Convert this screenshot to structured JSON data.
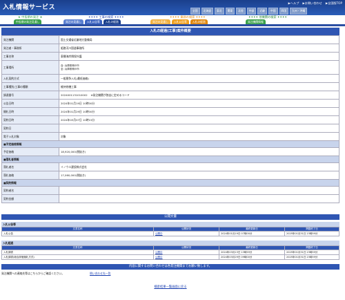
{
  "header": {
    "title": "入札情報サービス",
    "links": [
      "ヘルプ",
      "お問い合わせ",
      "全国版TOP"
    ],
    "prefs_row1": [
      "北海道",
      "東北",
      "関東",
      "北陸",
      "中部",
      "近畿",
      "中国",
      "四国",
      "九州・沖縄"
    ],
    "prefs_row2": [
      "全国",
      "北海道"
    ]
  },
  "sections": {
    "past_search": "中長期の発注",
    "construction": "工事の検索",
    "consult": "業務の検索",
    "local": "他機関の検索"
  },
  "tabs": [
    {
      "label": "中長期の発注見通し"
    },
    {
      "label": "発注の見通し"
    },
    {
      "label": "入札公告等"
    },
    {
      "label": "入札の経過"
    },
    {
      "label": "発注の見通し"
    },
    {
      "label": "入札公告等"
    },
    {
      "label": "入札の経過"
    },
    {
      "label": "発注機関情報"
    }
  ],
  "detail": {
    "title": "入札の経過(工事)案件概要",
    "rows": [
      {
        "label": "発注機関",
        "value": "国土交通省近畿地方整備局"
      },
      {
        "label": "発注者・事務所",
        "value": "姫路河川国道事務所"
      },
      {
        "label": "工事名称",
        "value": "東播海岸揖保外護"
      },
      {
        "label": "工事場所",
        "value": "自: 兵庫県神戸市",
        "value2": "至: 兵庫県神戸市"
      },
      {
        "label": "入札契約方式",
        "value": "一般競争入札(最低価格)"
      },
      {
        "label": "工事種別/工事の種類",
        "value": "維持修繕工事"
      },
      {
        "label": "調達番号",
        "value": "2024001131010002",
        "note": "※発注機関が独自に定めるコード"
      },
      {
        "label": "公告日時",
        "value": "2024年01月19日 10時00分"
      },
      {
        "label": "開札日時",
        "value": "2024年01月29日 10時00分"
      },
      {
        "label": "契約日時",
        "value": "2024年03月07日 10時15分"
      },
      {
        "label": "契約日",
        "value": ""
      },
      {
        "label": "電子入札対象",
        "value": "対象"
      }
    ],
    "price_head": "■予定価格情報",
    "price_rows": [
      {
        "label": "予定価格",
        "value": "18,920,000(税抜き)"
      }
    ],
    "winner_head": "■落札者情報",
    "winner_rows": [
      {
        "label": "落札者名",
        "value": "イノウエ建設株式会社"
      },
      {
        "label": "落札価格",
        "value": "17,060,000(税抜き)"
      }
    ],
    "contract_head": "■契約情報",
    "contract_rows": [
      {
        "label": "契約者名",
        "value": ""
      },
      {
        "label": "契約金額",
        "value": ""
      }
    ]
  },
  "docs": {
    "title": "公開文書",
    "columns": [
      "文書名称",
      "公開状況",
      "最終更新日",
      "掲載終了日"
    ],
    "group1": {
      "head": "入札公告等",
      "rows": [
        {
          "name": "入札公告",
          "status": "公開中",
          "updated": "2024年01月19日 07時00分",
          "end": "2025年01月31日 23時59分"
        }
      ]
    },
    "group2": {
      "head": "入札経過",
      "rows": [
        {
          "name": "入札調書",
          "status": "公開中",
          "updated": "2024年03月13日 13時59分",
          "end": "2025年01月31日 23時59分"
        },
        {
          "name": "入札調書(総合評価落札方式)",
          "status": "公開中",
          "updated": "2024年03月29日 09時00分",
          "end": "2025年01月31日 23時59分"
        }
      ]
    }
  },
  "footer": {
    "notice": "内容に関するお問い合わせは各発注機関までお願い致します。",
    "contact_label": "発注機関への連絡先等はこちらからご確認ください。",
    "contact_link": "問い合わせ先一覧",
    "back": "検索結果一覧画面に戻る"
  },
  "colors": {
    "header": "#1a3f8c",
    "accent": "#2f56b3",
    "tab_green": "#3aa04a",
    "tab_orange": "#f0a020",
    "tab_blue": "#3b62c0"
  }
}
